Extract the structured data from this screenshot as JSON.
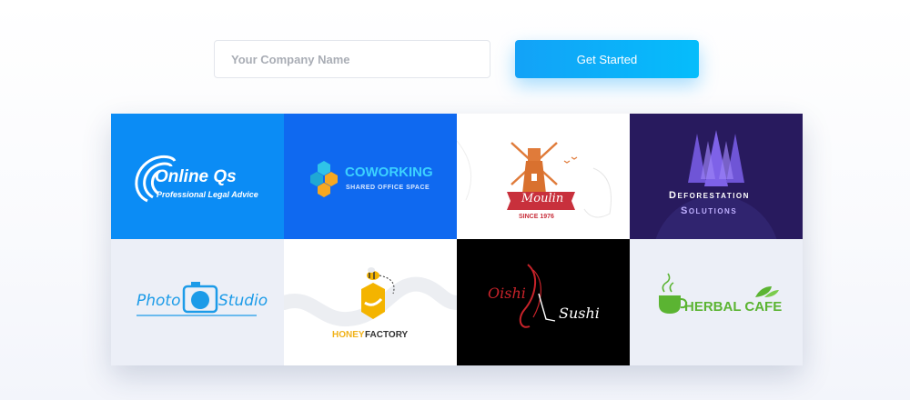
{
  "form": {
    "company_placeholder": "Your Company Name",
    "cta_label": "Get Started"
  },
  "logos": {
    "online": {
      "name": "Online Qs",
      "tagline": "Professional Legal Advice",
      "bg": "#0b8cf5"
    },
    "cowork": {
      "name": "COWORKING",
      "tagline": "SHARED OFFICE SPACE",
      "bg": "#0f69f0"
    },
    "moulin": {
      "name": "Moulin",
      "tagline": "SINCE 1976",
      "accent": "#d43a3a"
    },
    "defor": {
      "line1": "Deforestation",
      "line2": "Solutions",
      "bg": "#281a5e"
    },
    "photo": {
      "left": "Photo",
      "right": "Studio",
      "accent": "#1c9be8"
    },
    "honey": {
      "word1": "HONEY",
      "word2": "FACTORY",
      "accent": "#f0b21a"
    },
    "sushi": {
      "left": "Oishi",
      "right": "Sushi",
      "accent": "#c8232a"
    },
    "herbal": {
      "name": "HERBAL CAFE",
      "accent": "#5bb432"
    }
  }
}
